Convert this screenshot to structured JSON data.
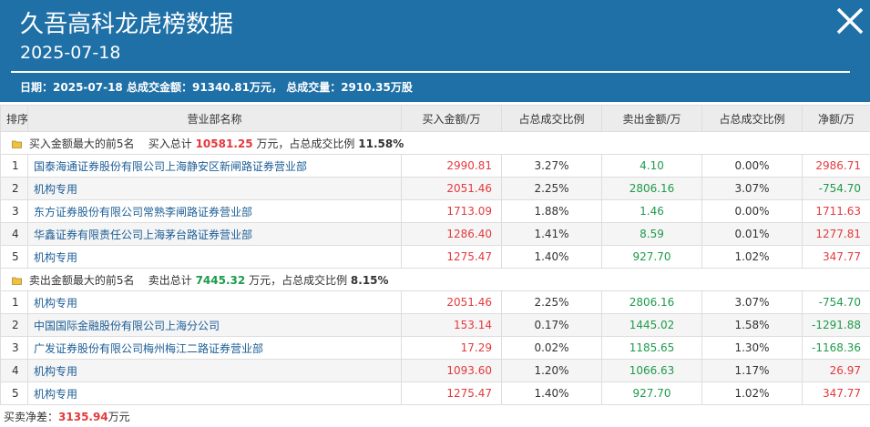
{
  "header": {
    "title": "久吾高科龙虎榜数据",
    "date": "2025-07-18",
    "summary_date_label": "日期：",
    "summary_date": "2025-07-18",
    "summary_amount_label": "总成交金额：",
    "summary_amount": "91340.81万元",
    "summary_volume_label": "总成交量：",
    "summary_volume": "2910.35万股",
    "bg_color": "#1f70a7"
  },
  "columns": [
    "排序",
    "营业部名称",
    "买入金额/万",
    "占总成交比例",
    "卖出金额/万",
    "占总成交比例",
    "净额/万"
  ],
  "buy_section": {
    "label": "买入金额最大的前5名",
    "total_label": "买入总计",
    "total": "10581.25",
    "unit": "万元，占总成交比例",
    "ratio": "11.58%"
  },
  "buy_rows": [
    {
      "rank": "1",
      "name": "国泰海通证券股份有限公司上海静安区新闸路证券营业部",
      "buy": "2990.81",
      "buy_ratio": "3.27%",
      "sell": "4.10",
      "sell_ratio": "0.00%",
      "net": "2986.71",
      "net_color": "red"
    },
    {
      "rank": "2",
      "name": "机构专用",
      "buy": "2051.46",
      "buy_ratio": "2.25%",
      "sell": "2806.16",
      "sell_ratio": "3.07%",
      "net": "-754.70",
      "net_color": "green"
    },
    {
      "rank": "3",
      "name": "东方证券股份有限公司常熟李闸路证券营业部",
      "buy": "1713.09",
      "buy_ratio": "1.88%",
      "sell": "1.46",
      "sell_ratio": "0.00%",
      "net": "1711.63",
      "net_color": "red"
    },
    {
      "rank": "4",
      "name": "华鑫证券有限责任公司上海茅台路证券营业部",
      "buy": "1286.40",
      "buy_ratio": "1.41%",
      "sell": "8.59",
      "sell_ratio": "0.01%",
      "net": "1277.81",
      "net_color": "red"
    },
    {
      "rank": "5",
      "name": "机构专用",
      "buy": "1275.47",
      "buy_ratio": "1.40%",
      "sell": "927.70",
      "sell_ratio": "1.02%",
      "net": "347.77",
      "net_color": "red"
    }
  ],
  "sell_section": {
    "label": "卖出金额最大的前5名",
    "total_label": "卖出总计",
    "total": "7445.32",
    "unit": "万元，占总成交比例",
    "ratio": "8.15%"
  },
  "sell_rows": [
    {
      "rank": "1",
      "name": "机构专用",
      "buy": "2051.46",
      "buy_ratio": "2.25%",
      "sell": "2806.16",
      "sell_ratio": "3.07%",
      "net": "-754.70",
      "net_color": "green"
    },
    {
      "rank": "2",
      "name": "中国国际金融股份有限公司上海分公司",
      "buy": "153.14",
      "buy_ratio": "0.17%",
      "sell": "1445.02",
      "sell_ratio": "1.58%",
      "net": "-1291.88",
      "net_color": "green"
    },
    {
      "rank": "3",
      "name": "广发证券股份有限公司梅州梅江二路证券营业部",
      "buy": "17.29",
      "buy_ratio": "0.02%",
      "sell": "1185.65",
      "sell_ratio": "1.30%",
      "net": "-1168.36",
      "net_color": "green"
    },
    {
      "rank": "4",
      "name": "机构专用",
      "buy": "1093.60",
      "buy_ratio": "1.20%",
      "sell": "1066.63",
      "sell_ratio": "1.17%",
      "net": "26.97",
      "net_color": "red"
    },
    {
      "rank": "5",
      "name": "机构专用",
      "buy": "1275.47",
      "buy_ratio": "1.40%",
      "sell": "927.70",
      "sell_ratio": "1.02%",
      "net": "347.77",
      "net_color": "red"
    }
  ],
  "footer": {
    "label": "买卖净差：",
    "value": "3135.94",
    "unit": "万元"
  },
  "icons": {
    "close": "close-icon",
    "section": "folder-icon"
  }
}
